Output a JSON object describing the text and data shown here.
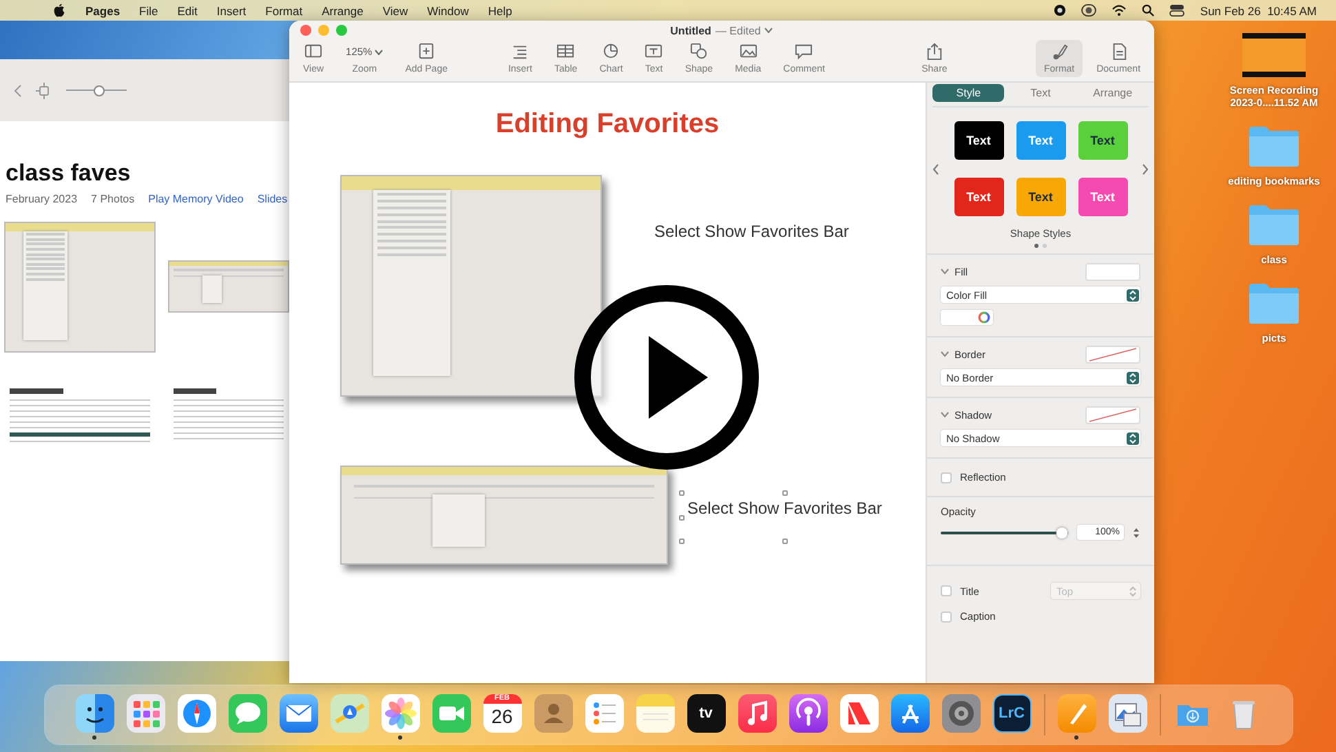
{
  "menu_bar": {
    "app": "Pages",
    "items": [
      "File",
      "Edit",
      "Insert",
      "Format",
      "Arrange",
      "View",
      "Window",
      "Help"
    ],
    "clock": "Sun Feb 26  10:45 AM"
  },
  "photos_window": {
    "zoom_slider": {
      "level": 0.55
    },
    "title": "class faves",
    "date": "February 2023",
    "count": "7 Photos",
    "actions": [
      "Play Memory Video",
      "Slides"
    ]
  },
  "pages_window": {
    "title": "Untitled",
    "status": "— Edited",
    "toolbar": [
      [
        {
          "kind": "view",
          "label": "View",
          "selected": false
        },
        {
          "kind": "zoom",
          "value": "125%",
          "label": "Zoom",
          "selected": false
        },
        {
          "kind": "add-page",
          "label": "Add Page",
          "selected": false
        }
      ],
      [
        {
          "kind": "insert",
          "label": "Insert",
          "selected": false
        },
        {
          "kind": "table",
          "label": "Table",
          "selected": false
        },
        {
          "kind": "chart",
          "label": "Chart",
          "selected": false
        },
        {
          "kind": "text",
          "label": "Text",
          "selected": false
        },
        {
          "kind": "shape",
          "label": "Shape",
          "selected": false
        },
        {
          "kind": "media",
          "label": "Media",
          "selected": false
        },
        {
          "kind": "comment",
          "label": "Comment",
          "selected": false
        }
      ],
      [
        {
          "kind": "share",
          "label": "Share",
          "selected": false
        }
      ],
      [
        {
          "kind": "format",
          "label": "Format",
          "selected": true
        },
        {
          "kind": "document",
          "label": "Document",
          "selected": false
        }
      ]
    ],
    "document": {
      "heading": "Editing Favorites",
      "steps": [
        {
          "kind": "menu",
          "caption": "Select Show Favorites Bar",
          "selected": false
        },
        {
          "kind": "bar",
          "caption": "Select Show Favorites Bar",
          "selected": true
        }
      ]
    },
    "inspector": {
      "tabs": [
        {
          "label": "Style",
          "selected": true
        },
        {
          "label": "Text",
          "selected": false
        },
        {
          "label": "Arrange",
          "selected": false
        }
      ],
      "shape_styles": [
        {
          "label": "Text",
          "color": "#000000"
        },
        {
          "label": "Text",
          "color": "#1a9bf0"
        },
        {
          "label": "Text",
          "color": "#5ad03c"
        },
        {
          "label": "Text",
          "color": "#e3261c"
        },
        {
          "label": "Text",
          "color": "#f8a805"
        },
        {
          "label": "Text",
          "color": "#f54ab0"
        }
      ],
      "shape_styles_title": "Shape Styles",
      "style_pages": [
        {
          "selected": true
        },
        {
          "selected": false
        }
      ],
      "sections": [
        {
          "kind": "fill",
          "title": "Fill",
          "expanded": true,
          "option": "Color Fill"
        },
        {
          "kind": "border",
          "title": "Border",
          "expanded": true,
          "option": "No Border"
        },
        {
          "kind": "shadow",
          "title": "Shadow",
          "expanded": true,
          "option": "No Shadow"
        }
      ],
      "reflection": {
        "label": "Reflection",
        "checked": false
      },
      "opacity": {
        "label": "Opacity",
        "level": 0.95,
        "value": "100%"
      },
      "title_option": {
        "label": "Title",
        "checked": false,
        "position": "Top",
        "disabled": true
      },
      "caption_option": {
        "label": "Caption",
        "checked": false
      }
    }
  },
  "desktop_icons": [
    {
      "kind": "video",
      "label": "Screen Recording 2023-0....11.52 AM"
    },
    {
      "kind": "folder",
      "label": "editing bookmarks"
    },
    {
      "kind": "folder",
      "label": "class"
    },
    {
      "kind": "folder",
      "label": "picts"
    }
  ],
  "dock": [
    [
      {
        "kind": "finder",
        "running": true
      },
      {
        "kind": "launchpad",
        "running": false
      },
      {
        "kind": "safari",
        "running": false
      },
      {
        "kind": "messages",
        "running": false
      },
      {
        "kind": "mail",
        "running": false
      },
      {
        "kind": "maps",
        "running": false
      },
      {
        "kind": "photos",
        "running": true
      },
      {
        "kind": "facetime",
        "running": false
      },
      {
        "kind": "calendar",
        "month": "FEB",
        "day": "26",
        "running": false
      },
      {
        "kind": "contacts",
        "running": false
      },
      {
        "kind": "reminders",
        "running": false
      },
      {
        "kind": "notes",
        "running": false
      },
      {
        "kind": "tv",
        "label": "tv",
        "running": false
      },
      {
        "kind": "music",
        "running": false
      },
      {
        "kind": "podcasts",
        "running": false
      },
      {
        "kind": "news",
        "running": false
      },
      {
        "kind": "app-store",
        "running": false
      },
      {
        "kind": "settings",
        "running": false
      },
      {
        "kind": "lightroom",
        "label": "LrC",
        "running": false
      }
    ],
    [
      {
        "kind": "pages",
        "running": true
      },
      {
        "kind": "preview",
        "running": false
      }
    ],
    [
      {
        "kind": "downloads",
        "running": false
      },
      {
        "kind": "trash",
        "running": false
      }
    ]
  ]
}
